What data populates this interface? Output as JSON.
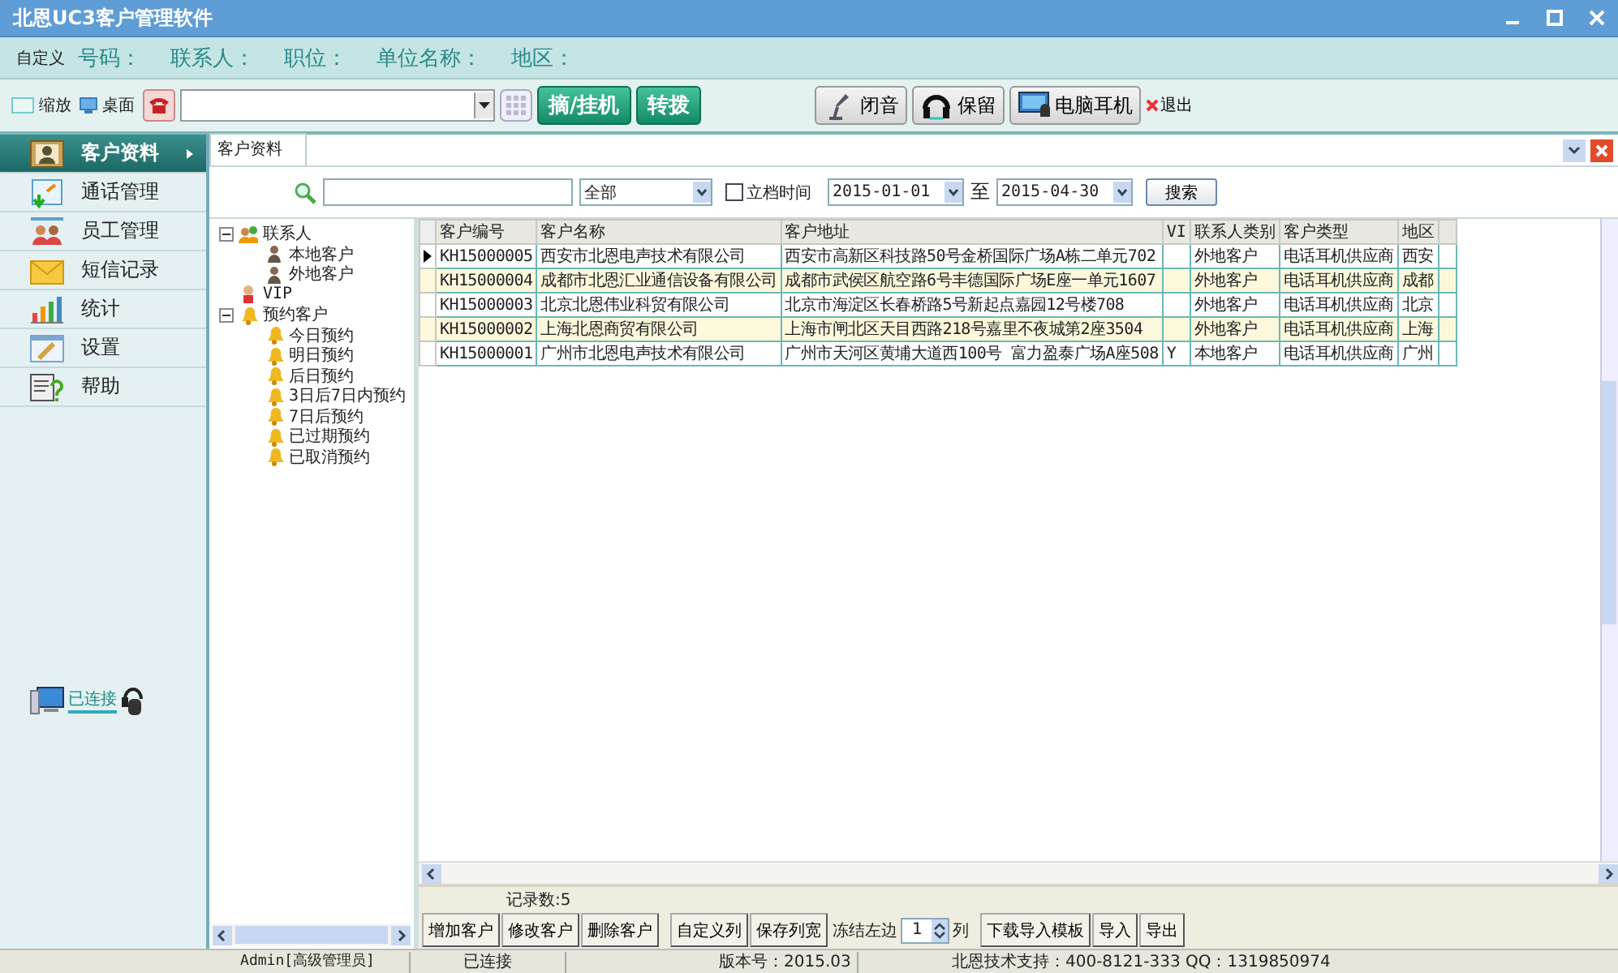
{
  "window": {
    "title": "北恩UC3客户管理软件"
  },
  "info_bar": {
    "customize": "自定义",
    "fields": [
      "号码：",
      "联系人：",
      "职位：",
      "单位名称：",
      "地区："
    ]
  },
  "toolbar": {
    "zoom": "缩放",
    "desktop": "桌面",
    "call_buttons": [
      "摘/挂机",
      "转拨"
    ],
    "device_buttons": [
      {
        "label": "闭音",
        "kind": "mic"
      },
      {
        "label": "保留",
        "kind": "headphones"
      },
      {
        "label": "电脑耳机",
        "kind": "monitor"
      }
    ],
    "exit": "退出"
  },
  "sidebar": {
    "items": [
      {
        "label": "客户资料",
        "selected": true
      },
      {
        "label": "通话管理",
        "selected": false
      },
      {
        "label": "员工管理",
        "selected": false
      },
      {
        "label": "短信记录",
        "selected": false
      },
      {
        "label": "统计",
        "selected": false
      },
      {
        "label": "设置",
        "selected": false
      },
      {
        "label": "帮助",
        "selected": false
      }
    ],
    "connection": "已连接"
  },
  "tabs": [
    {
      "label": "客户资料",
      "selected": true
    }
  ],
  "search": {
    "type_value": "全部",
    "date_filter": {
      "label": "立档时间",
      "checked": false
    },
    "from": "2015-01-01",
    "to_label": "至",
    "to": "2015-04-30",
    "button": "搜索"
  },
  "tree": [
    {
      "label": "联系人",
      "kind": "group",
      "expanded": true,
      "children": [
        {
          "label": "本地客户",
          "kind": "person"
        },
        {
          "label": "外地客户",
          "kind": "person"
        }
      ]
    },
    {
      "label": "VIP",
      "kind": "vip"
    },
    {
      "label": "预约客户",
      "kind": "bell",
      "expanded": true,
      "children": [
        {
          "label": "今日预约",
          "kind": "bell"
        },
        {
          "label": "明日预约",
          "kind": "bell"
        },
        {
          "label": "后日预约",
          "kind": "bell"
        },
        {
          "label": "3日后7日内预约",
          "kind": "bell"
        },
        {
          "label": "7日后预约",
          "kind": "bell"
        },
        {
          "label": "已过期预约",
          "kind": "bell"
        },
        {
          "label": "已取消预约",
          "kind": "bell"
        }
      ]
    }
  ],
  "table": {
    "columns": [
      "客户编号",
      "客户名称",
      "客户地址",
      "VI",
      "联系人类别",
      "客户类型",
      "地区"
    ],
    "rows": [
      {
        "selected": true,
        "cells": [
          "KH15000005",
          "西安市北恩电声技术有限公司",
          "西安市高新区科技路50号金桥国际广场A栋二单元702",
          null,
          "外地客户",
          "电话耳机供应商",
          "西安"
        ]
      },
      {
        "selected": false,
        "cells": [
          "KH15000004",
          "成都市北恩汇业通信设备有限公司",
          "成都市武侯区航空路6号丰德国际广场E座一单元1607",
          null,
          "外地客户",
          "电话耳机供应商",
          "成都"
        ]
      },
      {
        "selected": false,
        "cells": [
          "KH15000003",
          "北京北恩伟业科贸有限公司",
          "北京市海淀区长春桥路5号新起点嘉园12号楼708",
          null,
          "外地客户",
          "电话耳机供应商",
          "北京"
        ]
      },
      {
        "selected": false,
        "cells": [
          "KH15000002",
          "上海北恩商贸有限公司",
          "上海市闸北区天目西路218号嘉里不夜城第2座3504",
          null,
          "外地客户",
          "电话耳机供应商",
          "上海"
        ]
      },
      {
        "selected": false,
        "cells": [
          "KH15000001",
          "广州市北恩电声技术有限公司",
          "广州市天河区黄埔大道西100号 富力盈泰广场A座508",
          "Y",
          "本地客户",
          "电话耳机供应商",
          "广州"
        ]
      }
    ]
  },
  "record_count": "记录数:5",
  "actions": [
    "增加客户",
    "修改客户",
    "删除客户",
    "自定义列",
    "保存列宽"
  ],
  "freeze": {
    "label": "冻结左边",
    "value": "1",
    "suffix": "列"
  },
  "actions_2": [
    "下载导入模板",
    "导入",
    "导出"
  ],
  "status_bar": [
    "Admin[高级管理员]",
    "已连接",
    "版本号：2015.03",
    "北恩技术支持：400-8121-333 QQ：1319850974"
  ]
}
